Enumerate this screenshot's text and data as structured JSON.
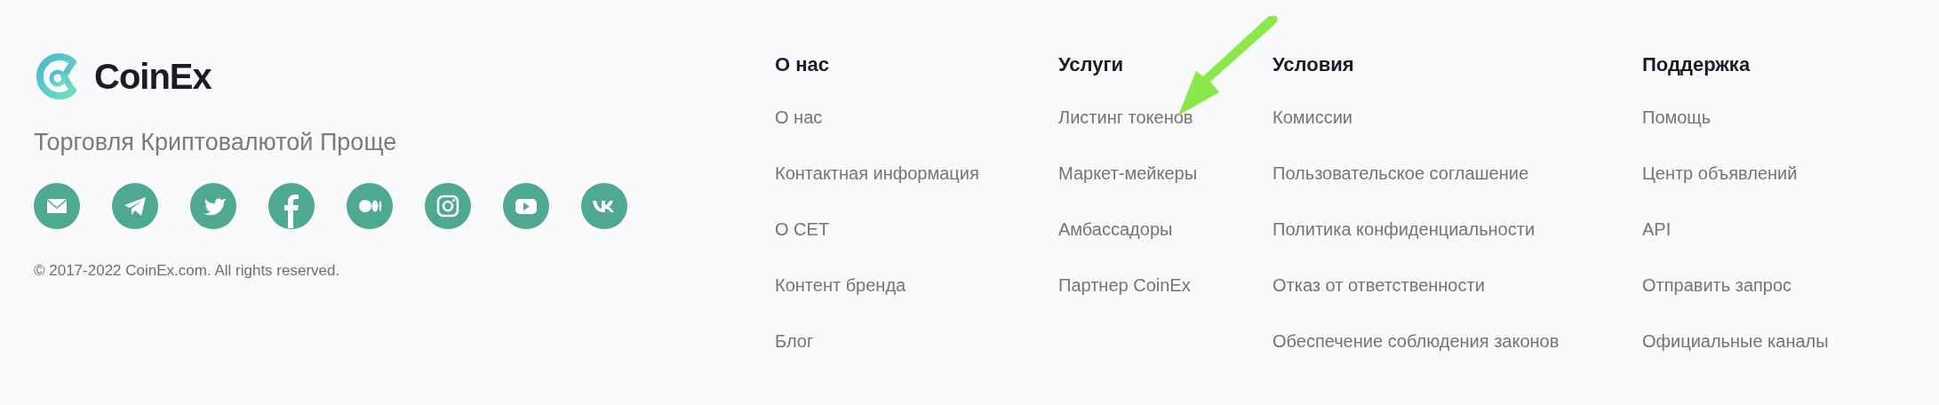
{
  "brand": {
    "name": "CoinEx",
    "tagline": "Торговля Криптовалютой Проще"
  },
  "social_links": [
    {
      "kind": "mail"
    },
    {
      "kind": "telegram"
    },
    {
      "kind": "twitter"
    },
    {
      "kind": "facebook"
    },
    {
      "kind": "medium"
    },
    {
      "kind": "instagram"
    },
    {
      "kind": "youtube"
    },
    {
      "kind": "vk"
    }
  ],
  "copyright": "© 2017-2022 CoinEx.com. All rights reserved.",
  "columns": [
    {
      "heading": "О нас",
      "links": [
        "О нас",
        "Контактная информация",
        "О CET",
        "Контент бренда",
        "Блог"
      ]
    },
    {
      "heading": "Услуги",
      "links": [
        "Листинг токенов",
        "Маркет-мейкеры",
        "Амбассадоры",
        "Партнер CoinEx"
      ]
    },
    {
      "heading": "Условия",
      "links": [
        "Комиссии",
        "Пользовательское соглашение",
        "Политика конфиденциальности",
        "Отказ от ответственности",
        "Обеспечение соблюдения законов"
      ]
    },
    {
      "heading": "Поддержка",
      "links": [
        "Помощь",
        "Центр объявлений",
        "API",
        "Отправить запрос",
        "Официальные каналы"
      ]
    }
  ]
}
